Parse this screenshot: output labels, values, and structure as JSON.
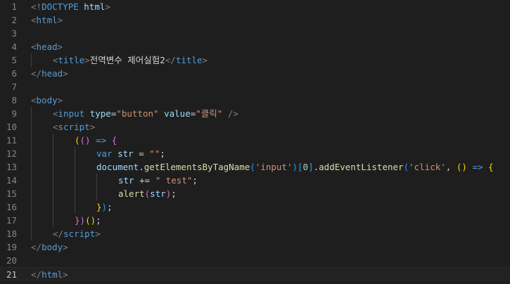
{
  "editor": {
    "theme_colors": {
      "background": "#1e1e1e",
      "line_number": "#858585",
      "line_number_active": "#c6c6c6",
      "tag": "#569cd6",
      "attribute": "#9cdcfe",
      "string": "#ce9178",
      "punctuation": "#808080",
      "text": "#d4d4d4",
      "function": "#dcdcaa",
      "number": "#b5cea8",
      "bracket_gold": "#ffd700",
      "bracket_pink": "#da70d6",
      "bracket_blue": "#179fff"
    },
    "current_line": 21,
    "lines": [
      {
        "num": "1",
        "indent": 0,
        "tokens": [
          {
            "t": "<!",
            "c": "punctuation"
          },
          {
            "t": "DOCTYPE",
            "c": "tag"
          },
          {
            "t": " ",
            "c": "text"
          },
          {
            "t": "html",
            "c": "attribute"
          },
          {
            "t": ">",
            "c": "punctuation"
          }
        ]
      },
      {
        "num": "2",
        "indent": 0,
        "tokens": [
          {
            "t": "<",
            "c": "punctuation"
          },
          {
            "t": "html",
            "c": "tag"
          },
          {
            "t": ">",
            "c": "punctuation"
          }
        ]
      },
      {
        "num": "3",
        "indent": 0,
        "tokens": []
      },
      {
        "num": "4",
        "indent": 0,
        "tokens": [
          {
            "t": "<",
            "c": "punctuation"
          },
          {
            "t": "head",
            "c": "tag"
          },
          {
            "t": ">",
            "c": "punctuation"
          }
        ]
      },
      {
        "num": "5",
        "indent": 1,
        "tokens": [
          {
            "t": "<",
            "c": "punctuation"
          },
          {
            "t": "title",
            "c": "tag"
          },
          {
            "t": ">",
            "c": "punctuation"
          },
          {
            "t": "전역변수 제어실험2",
            "c": "text"
          },
          {
            "t": "</",
            "c": "punctuation"
          },
          {
            "t": "title",
            "c": "tag"
          },
          {
            "t": ">",
            "c": "punctuation"
          }
        ]
      },
      {
        "num": "6",
        "indent": 0,
        "tokens": [
          {
            "t": "</",
            "c": "punctuation"
          },
          {
            "t": "head",
            "c": "tag"
          },
          {
            "t": ">",
            "c": "punctuation"
          }
        ]
      },
      {
        "num": "7",
        "indent": 0,
        "tokens": []
      },
      {
        "num": "8",
        "indent": 0,
        "tokens": [
          {
            "t": "<",
            "c": "punctuation"
          },
          {
            "t": "body",
            "c": "tag"
          },
          {
            "t": ">",
            "c": "punctuation"
          }
        ]
      },
      {
        "num": "9",
        "indent": 1,
        "tokens": [
          {
            "t": "<",
            "c": "punctuation"
          },
          {
            "t": "input",
            "c": "tag"
          },
          {
            "t": " ",
            "c": "text"
          },
          {
            "t": "type",
            "c": "attribute"
          },
          {
            "t": "=",
            "c": "text"
          },
          {
            "t": "\"button\"",
            "c": "string"
          },
          {
            "t": " ",
            "c": "text"
          },
          {
            "t": "value",
            "c": "attribute"
          },
          {
            "t": "=",
            "c": "text"
          },
          {
            "t": "\"클릭\"",
            "c": "string"
          },
          {
            "t": " />",
            "c": "punctuation"
          }
        ]
      },
      {
        "num": "10",
        "indent": 1,
        "tokens": [
          {
            "t": "<",
            "c": "punctuation"
          },
          {
            "t": "script",
            "c": "tag"
          },
          {
            "t": ">",
            "c": "punctuation"
          }
        ]
      },
      {
        "num": "11",
        "indent": 2,
        "tokens": [
          {
            "t": "(",
            "c": "bracket_gold"
          },
          {
            "t": "()",
            "c": "bracket_pink"
          },
          {
            "t": " ",
            "c": "text"
          },
          {
            "t": "=>",
            "c": "tag"
          },
          {
            "t": " ",
            "c": "text"
          },
          {
            "t": "{",
            "c": "bracket_pink"
          }
        ]
      },
      {
        "num": "12",
        "indent": 3,
        "tokens": [
          {
            "t": "var",
            "c": "tag"
          },
          {
            "t": " ",
            "c": "text"
          },
          {
            "t": "str",
            "c": "attribute"
          },
          {
            "t": " = ",
            "c": "text"
          },
          {
            "t": "\"\"",
            "c": "string"
          },
          {
            "t": ";",
            "c": "text"
          }
        ]
      },
      {
        "num": "13",
        "indent": 3,
        "tokens": [
          {
            "t": "document",
            "c": "attribute"
          },
          {
            "t": ".",
            "c": "text"
          },
          {
            "t": "getElementsByTagName",
            "c": "function"
          },
          {
            "t": "(",
            "c": "bracket_blue"
          },
          {
            "t": "'input'",
            "c": "string"
          },
          {
            "t": ")",
            "c": "bracket_blue"
          },
          {
            "t": "[",
            "c": "bracket_blue"
          },
          {
            "t": "0",
            "c": "number"
          },
          {
            "t": "]",
            "c": "bracket_blue"
          },
          {
            "t": ".",
            "c": "text"
          },
          {
            "t": "addEventListener",
            "c": "function"
          },
          {
            "t": "(",
            "c": "bracket_blue"
          },
          {
            "t": "'click'",
            "c": "string"
          },
          {
            "t": ", ",
            "c": "text"
          },
          {
            "t": "()",
            "c": "bracket_gold"
          },
          {
            "t": " ",
            "c": "text"
          },
          {
            "t": "=>",
            "c": "tag"
          },
          {
            "t": " ",
            "c": "text"
          },
          {
            "t": "{",
            "c": "bracket_gold"
          }
        ]
      },
      {
        "num": "14",
        "indent": 4,
        "tokens": [
          {
            "t": "str",
            "c": "attribute"
          },
          {
            "t": " += ",
            "c": "text"
          },
          {
            "t": "\" test\"",
            "c": "string"
          },
          {
            "t": ";",
            "c": "text"
          }
        ]
      },
      {
        "num": "15",
        "indent": 4,
        "tokens": [
          {
            "t": "alert",
            "c": "function"
          },
          {
            "t": "(",
            "c": "bracket_pink"
          },
          {
            "t": "str",
            "c": "attribute"
          },
          {
            "t": ")",
            "c": "bracket_pink"
          },
          {
            "t": ";",
            "c": "text"
          }
        ]
      },
      {
        "num": "16",
        "indent": 3,
        "tokens": [
          {
            "t": "}",
            "c": "bracket_gold"
          },
          {
            "t": ")",
            "c": "bracket_blue"
          },
          {
            "t": ";",
            "c": "text"
          }
        ]
      },
      {
        "num": "17",
        "indent": 2,
        "tokens": [
          {
            "t": "})",
            "c": "bracket_pink"
          },
          {
            "t": "()",
            "c": "bracket_gold"
          },
          {
            "t": ";",
            "c": "text"
          }
        ]
      },
      {
        "num": "18",
        "indent": 1,
        "tokens": [
          {
            "t": "</",
            "c": "punctuation"
          },
          {
            "t": "script",
            "c": "tag"
          },
          {
            "t": ">",
            "c": "punctuation"
          }
        ]
      },
      {
        "num": "19",
        "indent": 0,
        "tokens": [
          {
            "t": "</",
            "c": "punctuation"
          },
          {
            "t": "body",
            "c": "tag"
          },
          {
            "t": ">",
            "c": "punctuation"
          }
        ]
      },
      {
        "num": "20",
        "indent": 0,
        "tokens": []
      },
      {
        "num": "21",
        "indent": 0,
        "tokens": [
          {
            "t": "</",
            "c": "punctuation"
          },
          {
            "t": "html",
            "c": "tag"
          },
          {
            "t": ">",
            "c": "punctuation"
          }
        ]
      }
    ]
  }
}
